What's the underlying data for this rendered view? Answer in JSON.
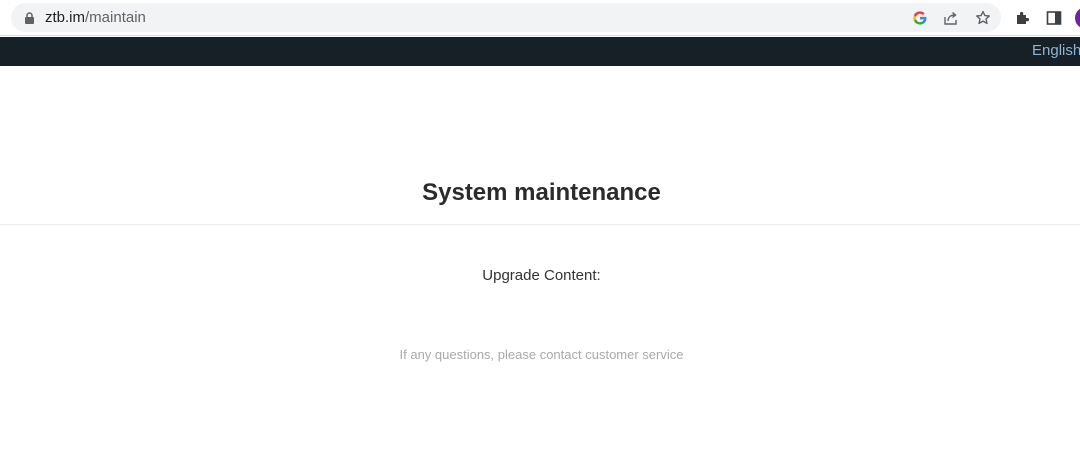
{
  "browser": {
    "url_host": "ztb.im",
    "url_path": "/maintain",
    "icons": [
      "lock-icon",
      "google-icon",
      "share-icon",
      "bookmark-star-icon",
      "extensions-icon",
      "side-panel-icon",
      "profile-avatar"
    ],
    "avatar_color": "#7b1fa2"
  },
  "header": {
    "language_label": "English",
    "background": "#172026",
    "link_color": "#8fb4d1"
  },
  "main": {
    "title": "System maintenance",
    "upgrade_label": "Upgrade Content:",
    "contact_note": "If any questions, please contact customer service"
  }
}
